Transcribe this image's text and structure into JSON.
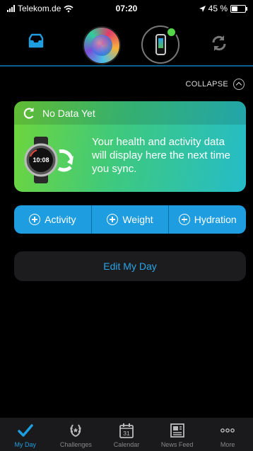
{
  "status_bar": {
    "carrier": "Telekom.de",
    "time": "07:20",
    "battery": "45 %",
    "battery_level": 0.45
  },
  "top_nav": {
    "items": [
      "inbox-icon",
      "avatar",
      "device",
      "sync-icon"
    ],
    "device_status_color": "#55d54a"
  },
  "collapse_label": "COLLAPSE",
  "card": {
    "title": "No Data Yet",
    "message": "Your health and activity data will display here the next time you sync.",
    "watch_time": "10:08"
  },
  "actions": [
    {
      "label": "Activity"
    },
    {
      "label": "Weight"
    },
    {
      "label": "Hydration"
    }
  ],
  "edit_label": "Edit My Day",
  "tabs": [
    {
      "label": "My Day",
      "icon": "check-icon"
    },
    {
      "label": "Challenges",
      "icon": "laurel-icon"
    },
    {
      "label": "Calendar",
      "icon": "calendar-icon"
    },
    {
      "label": "News Feed",
      "icon": "news-icon"
    },
    {
      "label": "More",
      "icon": "more-icon"
    }
  ],
  "calendar_day": "31",
  "accent_color": "#1e9de0"
}
